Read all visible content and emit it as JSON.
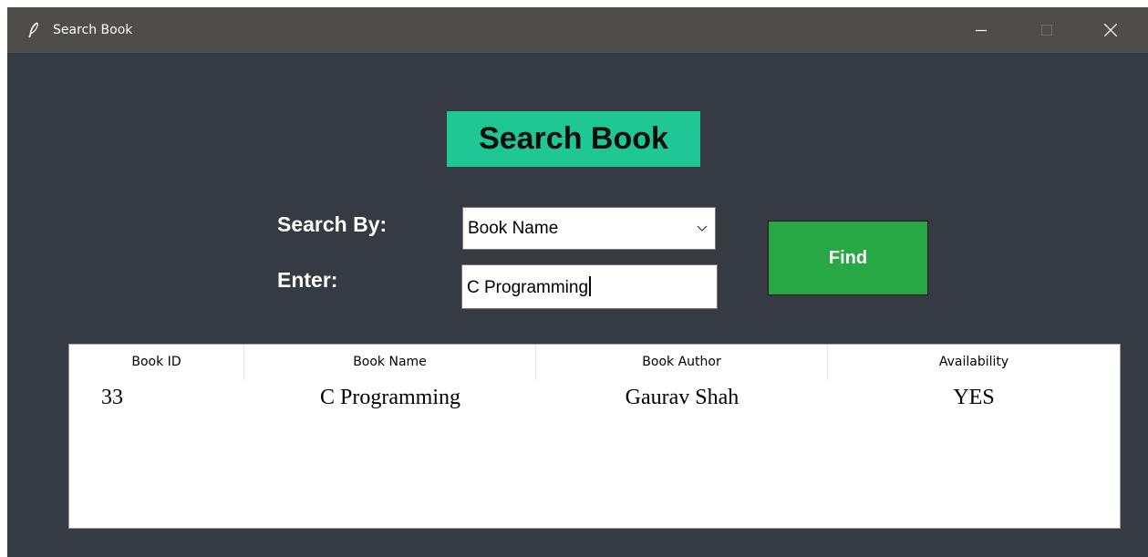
{
  "window": {
    "title": "Search Book",
    "controls": [
      "minimize-icon",
      "maximize-icon",
      "close-icon"
    ]
  },
  "page": {
    "heading": "Search Book"
  },
  "form": {
    "search_by_label": "Search By:",
    "search_by_value": "Book Name",
    "enter_label": "Enter:",
    "enter_value": "C Programming",
    "find_label": "Find"
  },
  "table": {
    "columns": [
      "Book ID",
      "Book Name",
      "Book Author",
      "Availability"
    ],
    "rows": [
      [
        "33",
        "C Programming",
        "Gaurav Shah",
        "YES"
      ]
    ]
  },
  "colors": {
    "window_bg": "#363a42",
    "titlebar_bg": "#4f4d49",
    "heading_bg": "#1fc794",
    "find_button_bg": "#28a745",
    "table_bg": "#ffffff"
  }
}
